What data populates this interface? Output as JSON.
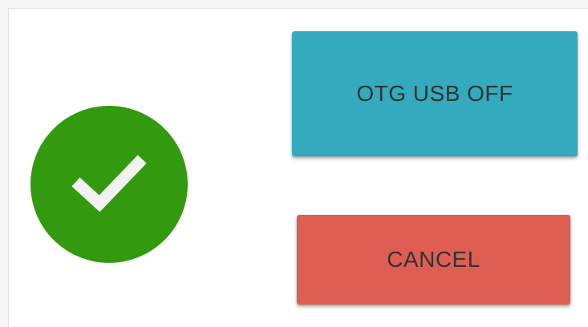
{
  "dialog": {
    "status_icon": "check-circle-icon",
    "primary_button_label": "OTG USB OFF",
    "cancel_button_label": "CANCEL"
  },
  "colors": {
    "success": "#339a0f",
    "check_mark": "#f2f2f2",
    "primary": "#33aabd",
    "cancel": "#de5e53",
    "button_text": "#333333"
  }
}
